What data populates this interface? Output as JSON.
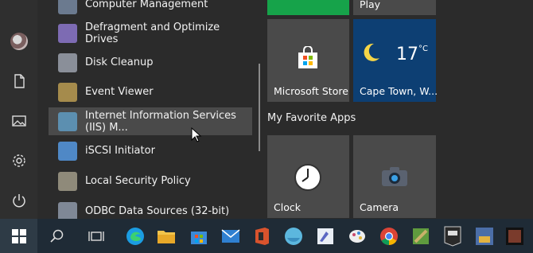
{
  "rail": {
    "items": [
      {
        "name": "user-avatar"
      },
      {
        "name": "documents-icon"
      },
      {
        "name": "pictures-icon"
      },
      {
        "name": "settings-icon"
      },
      {
        "name": "power-icon"
      }
    ]
  },
  "apps": [
    {
      "label": "Computer Management",
      "icon": "computer-management-icon",
      "color": "#6b7a8f"
    },
    {
      "label": "Defragment and Optimize Drives",
      "icon": "defragment-icon",
      "color": "#7d6bb3"
    },
    {
      "label": "Disk Cleanup",
      "icon": "disk-cleanup-icon",
      "color": "#8a8f99"
    },
    {
      "label": "Event Viewer",
      "icon": "event-viewer-icon",
      "color": "#a58b4c"
    },
    {
      "label": "Internet Information Services (IIS) M...",
      "icon": "iis-manager-icon",
      "color": "#5c8fb0"
    },
    {
      "label": "iSCSI Initiator",
      "icon": "iscsi-initiator-icon",
      "color": "#4f88c6"
    },
    {
      "label": "Local Security Policy",
      "icon": "security-policy-icon",
      "color": "#8f8a7a"
    },
    {
      "label": "ODBC Data Sources (32-bit)",
      "icon": "odbc-icon",
      "color": "#7f8896"
    }
  ],
  "tiles": {
    "play_label": "Play",
    "store_label": "Microsoft Store",
    "weather_city": "Cape Town, W...",
    "weather_temp": "17",
    "weather_unit": "°C",
    "group_title": "My Favorite Apps",
    "clock_label": "Clock",
    "camera_label": "Camera"
  },
  "taskbar": {
    "items": [
      {
        "name": "start-button",
        "color": "#2e3b46"
      },
      {
        "name": "search-button",
        "color": ""
      },
      {
        "name": "task-view-button",
        "color": ""
      },
      {
        "name": "edge-icon",
        "color": "#1b9de2"
      },
      {
        "name": "file-explorer-icon",
        "color": "#f2c44b"
      },
      {
        "name": "microsoft-store-icon",
        "color": "#3a8ad8"
      },
      {
        "name": "mail-icon",
        "color": "#2f80d1"
      },
      {
        "name": "office-icon",
        "color": "#d9532d"
      },
      {
        "name": "app-circle-icon",
        "color": "#5cb7de"
      },
      {
        "name": "sketch-app-icon",
        "color": "#5b67c2"
      },
      {
        "name": "paint-icon",
        "color": "#c94a6e"
      },
      {
        "name": "chrome-icon",
        "color": "#e2b53a"
      },
      {
        "name": "minecraft-icon",
        "color": "#5f9b3e"
      },
      {
        "name": "epic-games-icon",
        "color": "#2a2a2a"
      },
      {
        "name": "game-icon",
        "color": "#4b6ea8"
      },
      {
        "name": "game2-icon",
        "color": "#7a3b2c"
      }
    ]
  },
  "colors": {
    "green_tile": "#16a34a",
    "weather_bg": "#0d3f73"
  }
}
